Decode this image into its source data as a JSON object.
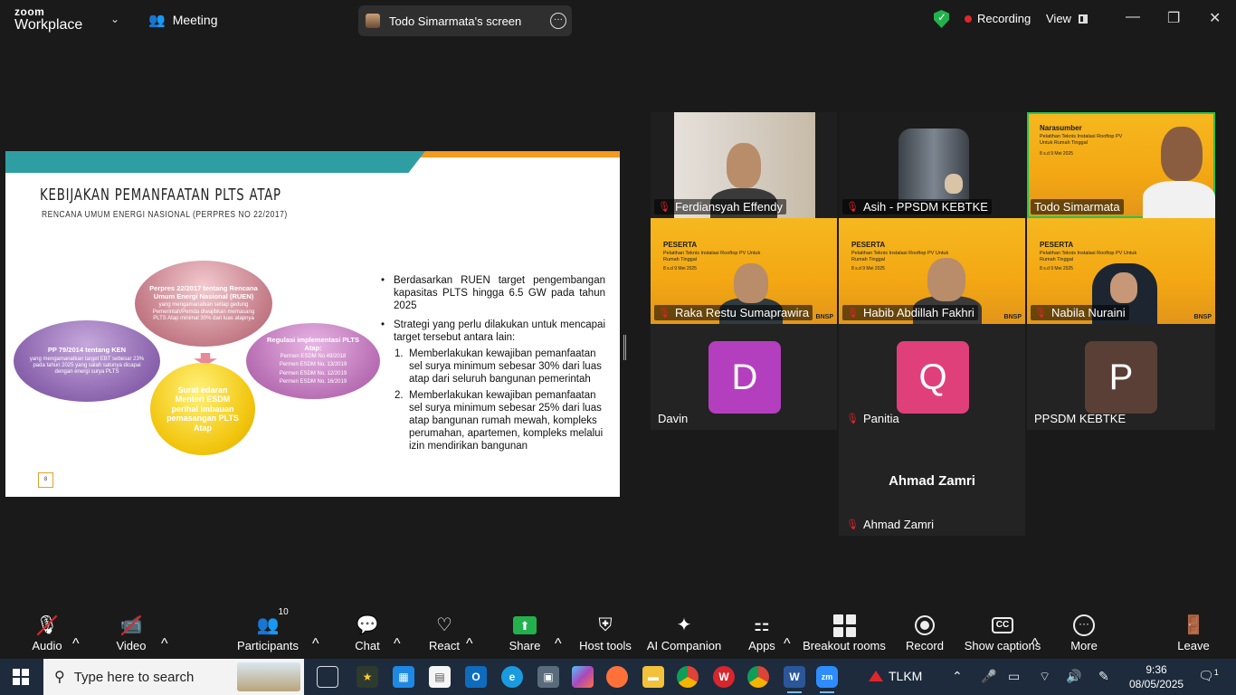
{
  "app": {
    "brand_top": "zoom",
    "brand_bottom": "Workplace",
    "meeting_label": "Meeting"
  },
  "screen_share": {
    "label": "Todo Simarmata's screen"
  },
  "status": {
    "recording": "Recording",
    "view": "View"
  },
  "slide": {
    "title": "KEBIJAKAN PEMANFAATAN PLTS ATAP",
    "subtitle": "RENCANA UMUM ENERGI NASIONAL (PERPRES NO 22/2017)",
    "ellipse_top": {
      "heading": "Perpres 22/2017 tentang Rencana Umum Energi Nasional (RUEN)",
      "body": "yang mengamanatkan setiap gedung Pemerintah/Pemda diwajibkan memasang PLTS Atap minimal 30% dari luas atapnya"
    },
    "ellipse_left": {
      "heading": "PP 79/2014 tentang KEN",
      "body": "yang mengamanatkan target EBT sebesar 23% pada tahun 2025 yang salah satunya dicapai dengan energi surya PLTS"
    },
    "ellipse_right": {
      "heading": "Regulasi implementasi PLTS Atap:",
      "items": [
        "Permen ESDM No.49/2018",
        "Permen ESDM No. 13/2019",
        "Permen ESDM No. 12/2019",
        "Permen ESDM No. 16/2019"
      ]
    },
    "ellipse_bottom": {
      "heading": "Surat edaran Menteri ESDM perihal imbauan pemasangan PLTS Atap"
    },
    "page_number": "8",
    "bullet1": "Berdasarkan RUEN target pengembangan kapasitas PLTS hingga 6.5 GW pada tahun 2025",
    "bullet2": "Strategi yang perlu dilakukan untuk mencapai target tersebut antara lain:",
    "numbered": [
      {
        "n": "1.",
        "text": "Memberlakukan kewajiban pemanfaatan sel surya minimum sebesar 30% dari luas atap dari seluruh bangunan pemerintah"
      },
      {
        "n": "2.",
        "text": "Memberlakukan kewajiban pemanfaatan sel surya minimum sebesar 25% dari luas atap bangunan rumah mewah, kompleks perumahan, apartemen, kompleks melalui izin mendirikan bangunan"
      }
    ]
  },
  "participants": {
    "ferdiansyah": "Ferdiansyah Effendy",
    "asih": "Asih - PPSDM KEBTKE",
    "todo": "Todo Simarmata",
    "raka": "Raka Restu Sumaprawira",
    "habib": "Habib Abdillah Fakhri",
    "nabila": "Nabila Nuraini",
    "davin": "Davin",
    "panitia": "Panitia",
    "ppsdm": "PPSDM KEBTKE",
    "ahmad": "Ahmad Zamri"
  },
  "avatar_letters": {
    "davin": "D",
    "panitia": "Q",
    "ppsdm": "P"
  },
  "avatar_colors": {
    "davin": "#b43fbe",
    "panitia": "#e0407a",
    "ppsdm": "#5a3f36"
  },
  "banner": {
    "narasumber": "Narasumber",
    "peserta": "PESERTA",
    "subtitle": "Pelatihan Teknis Instalasi Rooftop PV Untuk Rumah Tinggal",
    "date": "8 s.d 9 Mei 2025",
    "bnsp": "BNSP"
  },
  "toolbar": {
    "audio": "Audio",
    "video": "Video",
    "participants": "Participants",
    "participants_count": "10",
    "chat": "Chat",
    "react": "React",
    "share": "Share",
    "host_tools": "Host tools",
    "ai": "AI Companion",
    "apps": "Apps",
    "breakout": "Breakout rooms",
    "record": "Record",
    "captions": "Show captions",
    "more": "More",
    "leave": "Leave"
  },
  "taskbar": {
    "search_placeholder": "Type here to search",
    "tlkm": "TLKM",
    "time": "9:36",
    "date": "08/05/2025",
    "notifications": "1"
  },
  "icons": [
    "windows-icon",
    "search-icon",
    "task-view-icon",
    "file-explorer-icon",
    "chrome-icon",
    "word-icon",
    "zoom-icon",
    "edge-icon",
    "outlook-icon",
    "firefox-icon",
    "wifi-icon",
    "speaker-icon",
    "battery-icon",
    "microphone-icon",
    "notification-icon"
  ]
}
